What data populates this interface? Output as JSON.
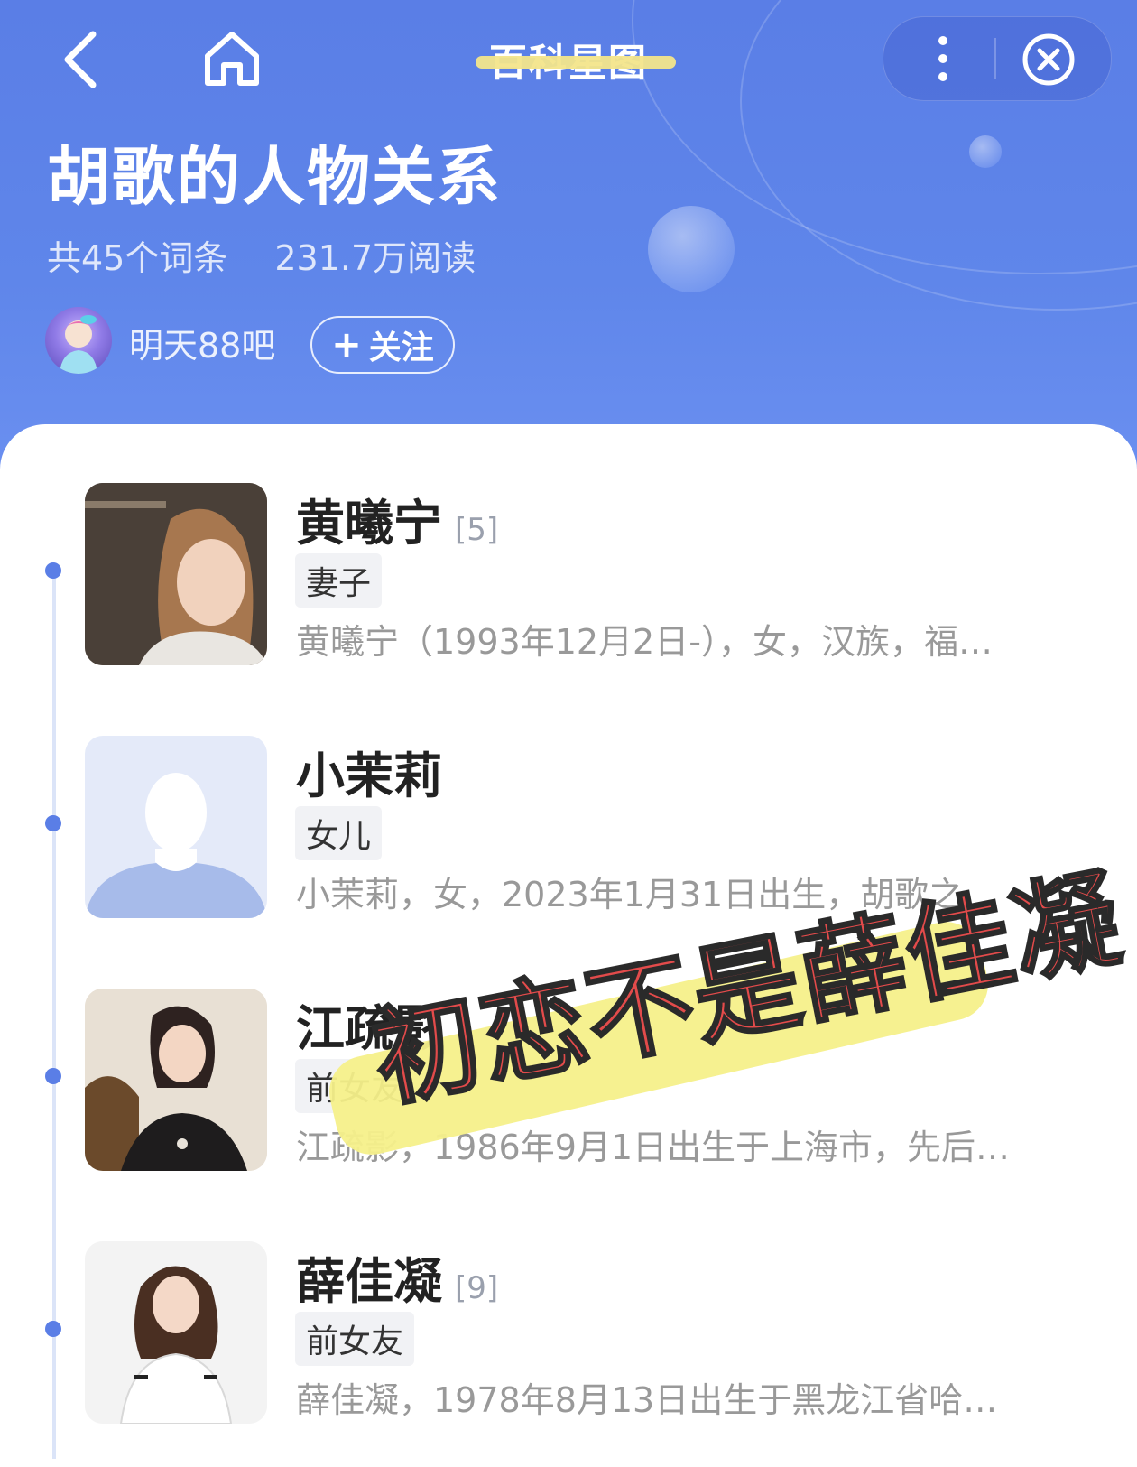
{
  "nav": {
    "title": "百科星图"
  },
  "header": {
    "title": "胡歌的人物关系",
    "entries": "共45个词条",
    "reads": "231.7万阅读",
    "author": "明天88吧",
    "follow_label": "关注"
  },
  "relations": [
    {
      "name": "黄曦宁",
      "ref": "[5]",
      "relation": "妻子",
      "desc": "黄曦宁（1993年12月2日-），女，汉族，福…"
    },
    {
      "name": "小茉莉",
      "ref": "",
      "relation": "女儿",
      "desc": "小茉莉，女，2023年1月31日出生，胡歌之…"
    },
    {
      "name": "江疏影",
      "ref": "",
      "relation": "前女友",
      "desc": "江疏影，1986年9月1日出生于上海市，先后…"
    },
    {
      "name": "薛佳凝",
      "ref": "[9]",
      "relation": "前女友",
      "desc": "薛佳凝，1978年8月13日出生于黑龙江省哈…"
    }
  ],
  "overlay": {
    "text": "初恋不是薛佳凝"
  },
  "colors": {
    "header_blue": "#5a7ee6",
    "timeline_dot": "#5a7ee6",
    "overlay_text": "#e34b4b",
    "overlay_highlight": "#f6f08a"
  }
}
